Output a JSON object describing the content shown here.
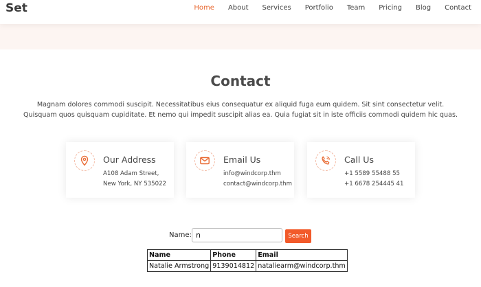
{
  "header": {
    "brand": "Set",
    "nav": [
      "Home",
      "About",
      "Services",
      "Portfolio",
      "Team",
      "Pricing",
      "Blog",
      "Contact"
    ],
    "active": "Home",
    "accent": "#e96b34"
  },
  "contact": {
    "title": "Contact",
    "description": "Magnam dolores commodi suscipit. Necessitatibus eius consequatur ex aliquid fuga eum quidem. Sit sint consectetur velit. Quisquam quos quisquam cupiditate. Et nemo qui impedit suscipit alias ea. Quia fugiat sit in iste officiis commodi quidem hic quas.",
    "cards": [
      {
        "icon": "map-pin-icon",
        "title": "Our Address",
        "lines": [
          "A108 Adam Street,",
          "New York, NY 535022"
        ]
      },
      {
        "icon": "envelope-icon",
        "title": "Email Us",
        "lines": [
          "info@windcorp.thm",
          "contact@windcorp.thm"
        ]
      },
      {
        "icon": "phone-icon",
        "title": "Call Us",
        "lines": [
          "+1 5589 55488 55",
          "+1 6678 254445 41"
        ]
      }
    ]
  },
  "search": {
    "label": "Name:",
    "value": "n",
    "button": "Search",
    "button_color": "#f25a2a"
  },
  "results": {
    "columns": [
      "Name",
      "Phone",
      "Email"
    ],
    "rows": [
      [
        "Natalie Armstrong",
        "9139014812",
        "nataliearm@windcorp.thm"
      ]
    ]
  }
}
